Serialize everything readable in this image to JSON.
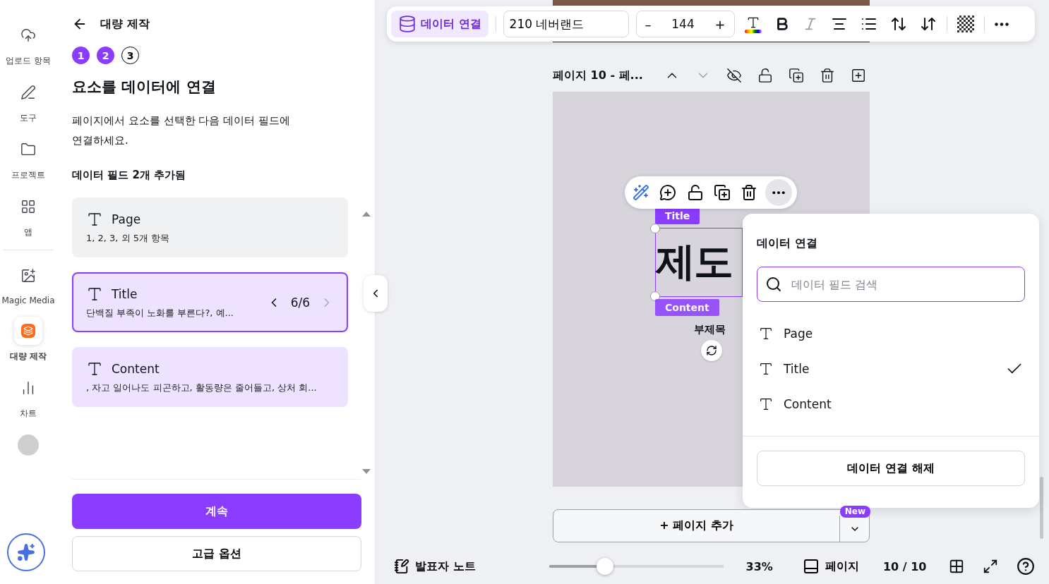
{
  "rail": {
    "items": [
      {
        "label": "업로드 항목",
        "kind": "upload",
        "selected": false
      },
      {
        "label": "도구",
        "kind": "draw",
        "selected": false
      },
      {
        "label": "프로젝트",
        "kind": "folder",
        "selected": false
      },
      {
        "label": "앱",
        "kind": "apps",
        "selected": false
      },
      {
        "label": "Magic Media",
        "kind": "magic",
        "selected": false
      },
      {
        "label": "대량 제작",
        "kind": "bulk",
        "selected": true
      },
      {
        "label": "차트",
        "kind": "chart",
        "selected": false
      },
      {
        "kind": "avatar",
        "selected": false
      }
    ]
  },
  "panel": {
    "title": "대량 제작",
    "steps": [
      {
        "label": "1",
        "done": true
      },
      {
        "label": "2",
        "done": true
      },
      {
        "label": "3",
        "done": false
      }
    ],
    "heading": "요소를 데이터에 연결",
    "description": "페이지에서 요소를 선택한 다음 데이터 필드에 연결하세요.",
    "fields_heading": "데이터 필드 2개 추가됨",
    "fields": [
      {
        "name": "Page",
        "preview": "1, 2, 3, 외 5개 항목",
        "selected": false,
        "linked": false
      },
      {
        "name": "Title",
        "preview": "단백질 부족이 노화를 부른다?, 예...",
        "selected": true,
        "linked": true,
        "pager": "6/6",
        "next_disabled": true
      },
      {
        "name": "Content",
        "preview": ", 자고 일어나도 피곤하고, 활동량은 줄어들고, 상처 회...",
        "selected": false,
        "linked": true
      }
    ],
    "primary_button": "계속",
    "secondary_button": "고급 옵션"
  },
  "toolbar": {
    "data_button": "데이터 연결",
    "data_active": true,
    "font": "210 네버랜드",
    "font_size": "144",
    "minus": "–",
    "plus": "+",
    "italic_disabled": true
  },
  "page_header": {
    "title": "페이지 10 - 페...",
    "down_disabled": true
  },
  "canvas": {
    "title_tag": "Title",
    "content_tag": "Content",
    "big_text": "제도",
    "subtitle": "부제목"
  },
  "popup": {
    "title": "데이터 연결",
    "search_placeholder": "데이터 필드 검색",
    "items": [
      {
        "name": "Page",
        "checked": false
      },
      {
        "name": "Title",
        "checked": true
      },
      {
        "name": "Content",
        "checked": false
      }
    ],
    "unlink_button": "데이터 연결 해제"
  },
  "add_page": {
    "label": "+ 페이지 추가",
    "badge": "New"
  },
  "status_bar": {
    "notes": "발표자 노트",
    "zoom": {
      "level": 0.32
    },
    "zoom_reading": "33%",
    "pages_label": "페이지",
    "page_count": "10 / 10"
  }
}
